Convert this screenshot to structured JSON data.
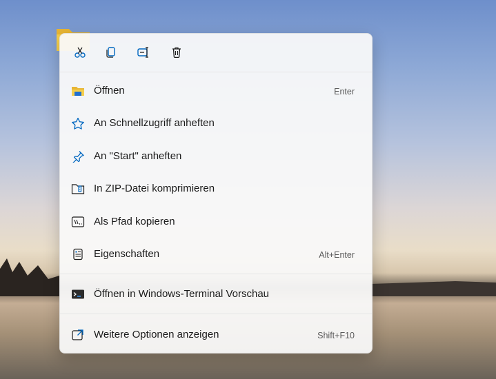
{
  "toolbar": {
    "cut": "cut-icon",
    "copy": "copy-icon",
    "rename": "rename-icon",
    "delete": "delete-icon"
  },
  "menu_items": [
    {
      "label": "Öffnen",
      "shortcut": "Enter",
      "icon": "folder-open-icon"
    },
    {
      "label": "An Schnellzugriff anheften",
      "shortcut": "",
      "icon": "star-icon"
    },
    {
      "label": "An \"Start\" anheften",
      "shortcut": "",
      "icon": "pin-icon"
    },
    {
      "label": "In ZIP-Datei komprimieren",
      "shortcut": "",
      "icon": "zip-icon"
    },
    {
      "label": "Als Pfad kopieren",
      "shortcut": "",
      "icon": "copy-path-icon"
    },
    {
      "label": "Eigenschaften",
      "shortcut": "Alt+Enter",
      "icon": "properties-icon"
    },
    {
      "label": "Öffnen in Windows-Terminal Vorschau",
      "shortcut": "",
      "icon": "terminal-icon"
    },
    {
      "label": "Weitere Optionen anzeigen",
      "shortcut": "Shift+F10",
      "icon": "more-options-icon"
    }
  ],
  "colors": {
    "accent": "#0067c0",
    "menu_bg": "#f9f9f9"
  }
}
